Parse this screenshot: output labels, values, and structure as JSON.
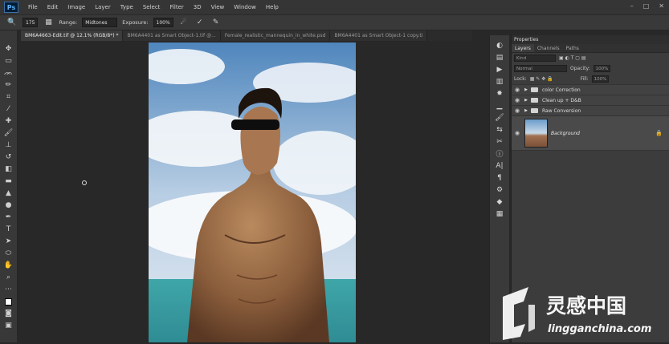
{
  "menubar": {
    "logo": "Ps",
    "items": [
      "File",
      "Edit",
      "Image",
      "Layer",
      "Type",
      "Select",
      "Filter",
      "3D",
      "View",
      "Window",
      "Help"
    ],
    "window_controls": [
      "–",
      "□",
      "✕"
    ]
  },
  "options": {
    "size": "175",
    "range_label": "Range:",
    "range_value": "Midtones",
    "exposure_label": "Exposure:",
    "exposure_value": "100%"
  },
  "tabs": [
    "BM6A4663-Edit.tif @ 12.1% (RGB/8*) *",
    "BM6A4401 as Smart Object-1.tif @...",
    "Female_realistic_mannequin_in_white.psd",
    "BM6A4401 as Smart Object-1 copy.ti"
  ],
  "panel": {
    "title": "Properties",
    "tabs": [
      "Layers",
      "Channels",
      "Paths"
    ],
    "kind": "Kind",
    "blend": "Normal",
    "opacity_label": "Opacity:",
    "opacity_value": "100%",
    "lock_label": "Lock:",
    "fill_label": "Fill:",
    "fill_value": "100%",
    "layers": [
      {
        "name": "color Correction"
      },
      {
        "name": "Clean up + D&B"
      },
      {
        "name": "Raw Conversion"
      }
    ],
    "background": "Background"
  },
  "watermark": {
    "cn": "灵感中国",
    "url": "lingganchina.com"
  },
  "colors": {
    "bg": "#282828",
    "panel": "#3c3c3c",
    "accent": "#5fb2f5"
  }
}
